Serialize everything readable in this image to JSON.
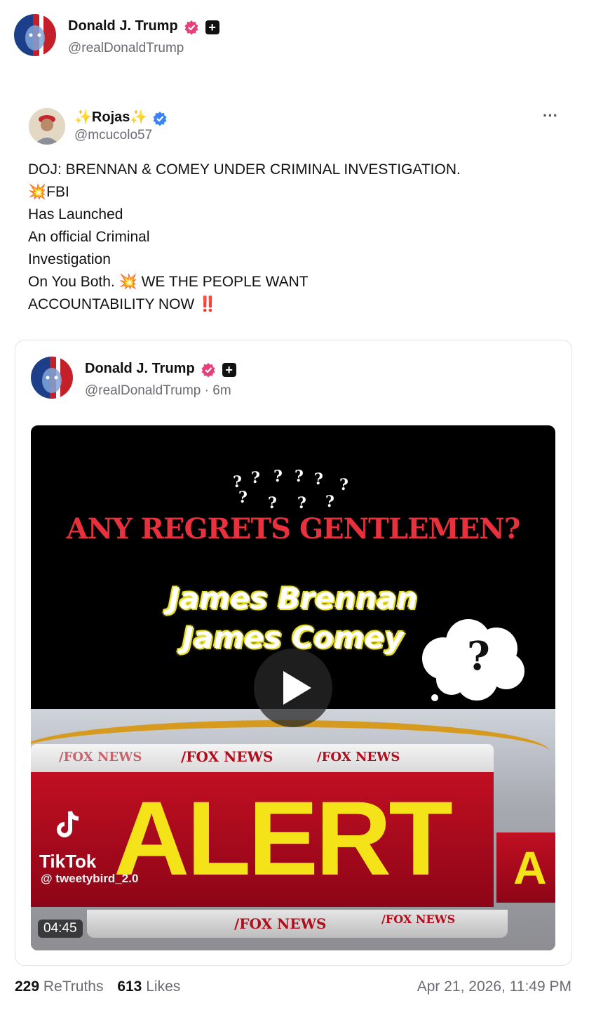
{
  "author": {
    "name": "Donald J. Trump",
    "handle": "@realDonaldTrump"
  },
  "retruth": {
    "name_prefix": "✨",
    "name": "Rojas",
    "name_suffix": "✨",
    "handle": "@mcucolo57",
    "menu": "···",
    "lines": [
      "DOJ: BRENNAN & COMEY UNDER CRIMINAL INVESTIGATION.",
      "💥FBI",
      "Has Launched",
      "An official Criminal",
      "Investigation",
      "On You Both. 💥 WE THE PEOPLE WANT",
      "ACCOUNTABILITY NOW ‼️"
    ]
  },
  "quoted": {
    "name": "Donald J. Trump",
    "handle": "@realDonaldTrump · 6m"
  },
  "video": {
    "headline": "ANY REGRETS GENTLEMEN?",
    "name1": "James Brennan",
    "name2": "James Comey",
    "question": "?",
    "network_tag": "/FOX NEWS",
    "alert": "ALERT",
    "alert_right": "A",
    "tiktok_label": "TikTok",
    "tiktok_user": "@ tweetybird_2.0",
    "duration": "04:45"
  },
  "stats": {
    "retruths_count": "229",
    "retruths_label": "ReTruths",
    "likes_count": "613",
    "likes_label": "Likes",
    "timestamp": "Apr 21, 2026, 11:49 PM"
  },
  "colors": {
    "badge": "#e5407a",
    "verified": "#3b82f6",
    "headline": "#e8313c",
    "alert_yellow": "#f5e31a",
    "alert_red": "#a6081a"
  }
}
